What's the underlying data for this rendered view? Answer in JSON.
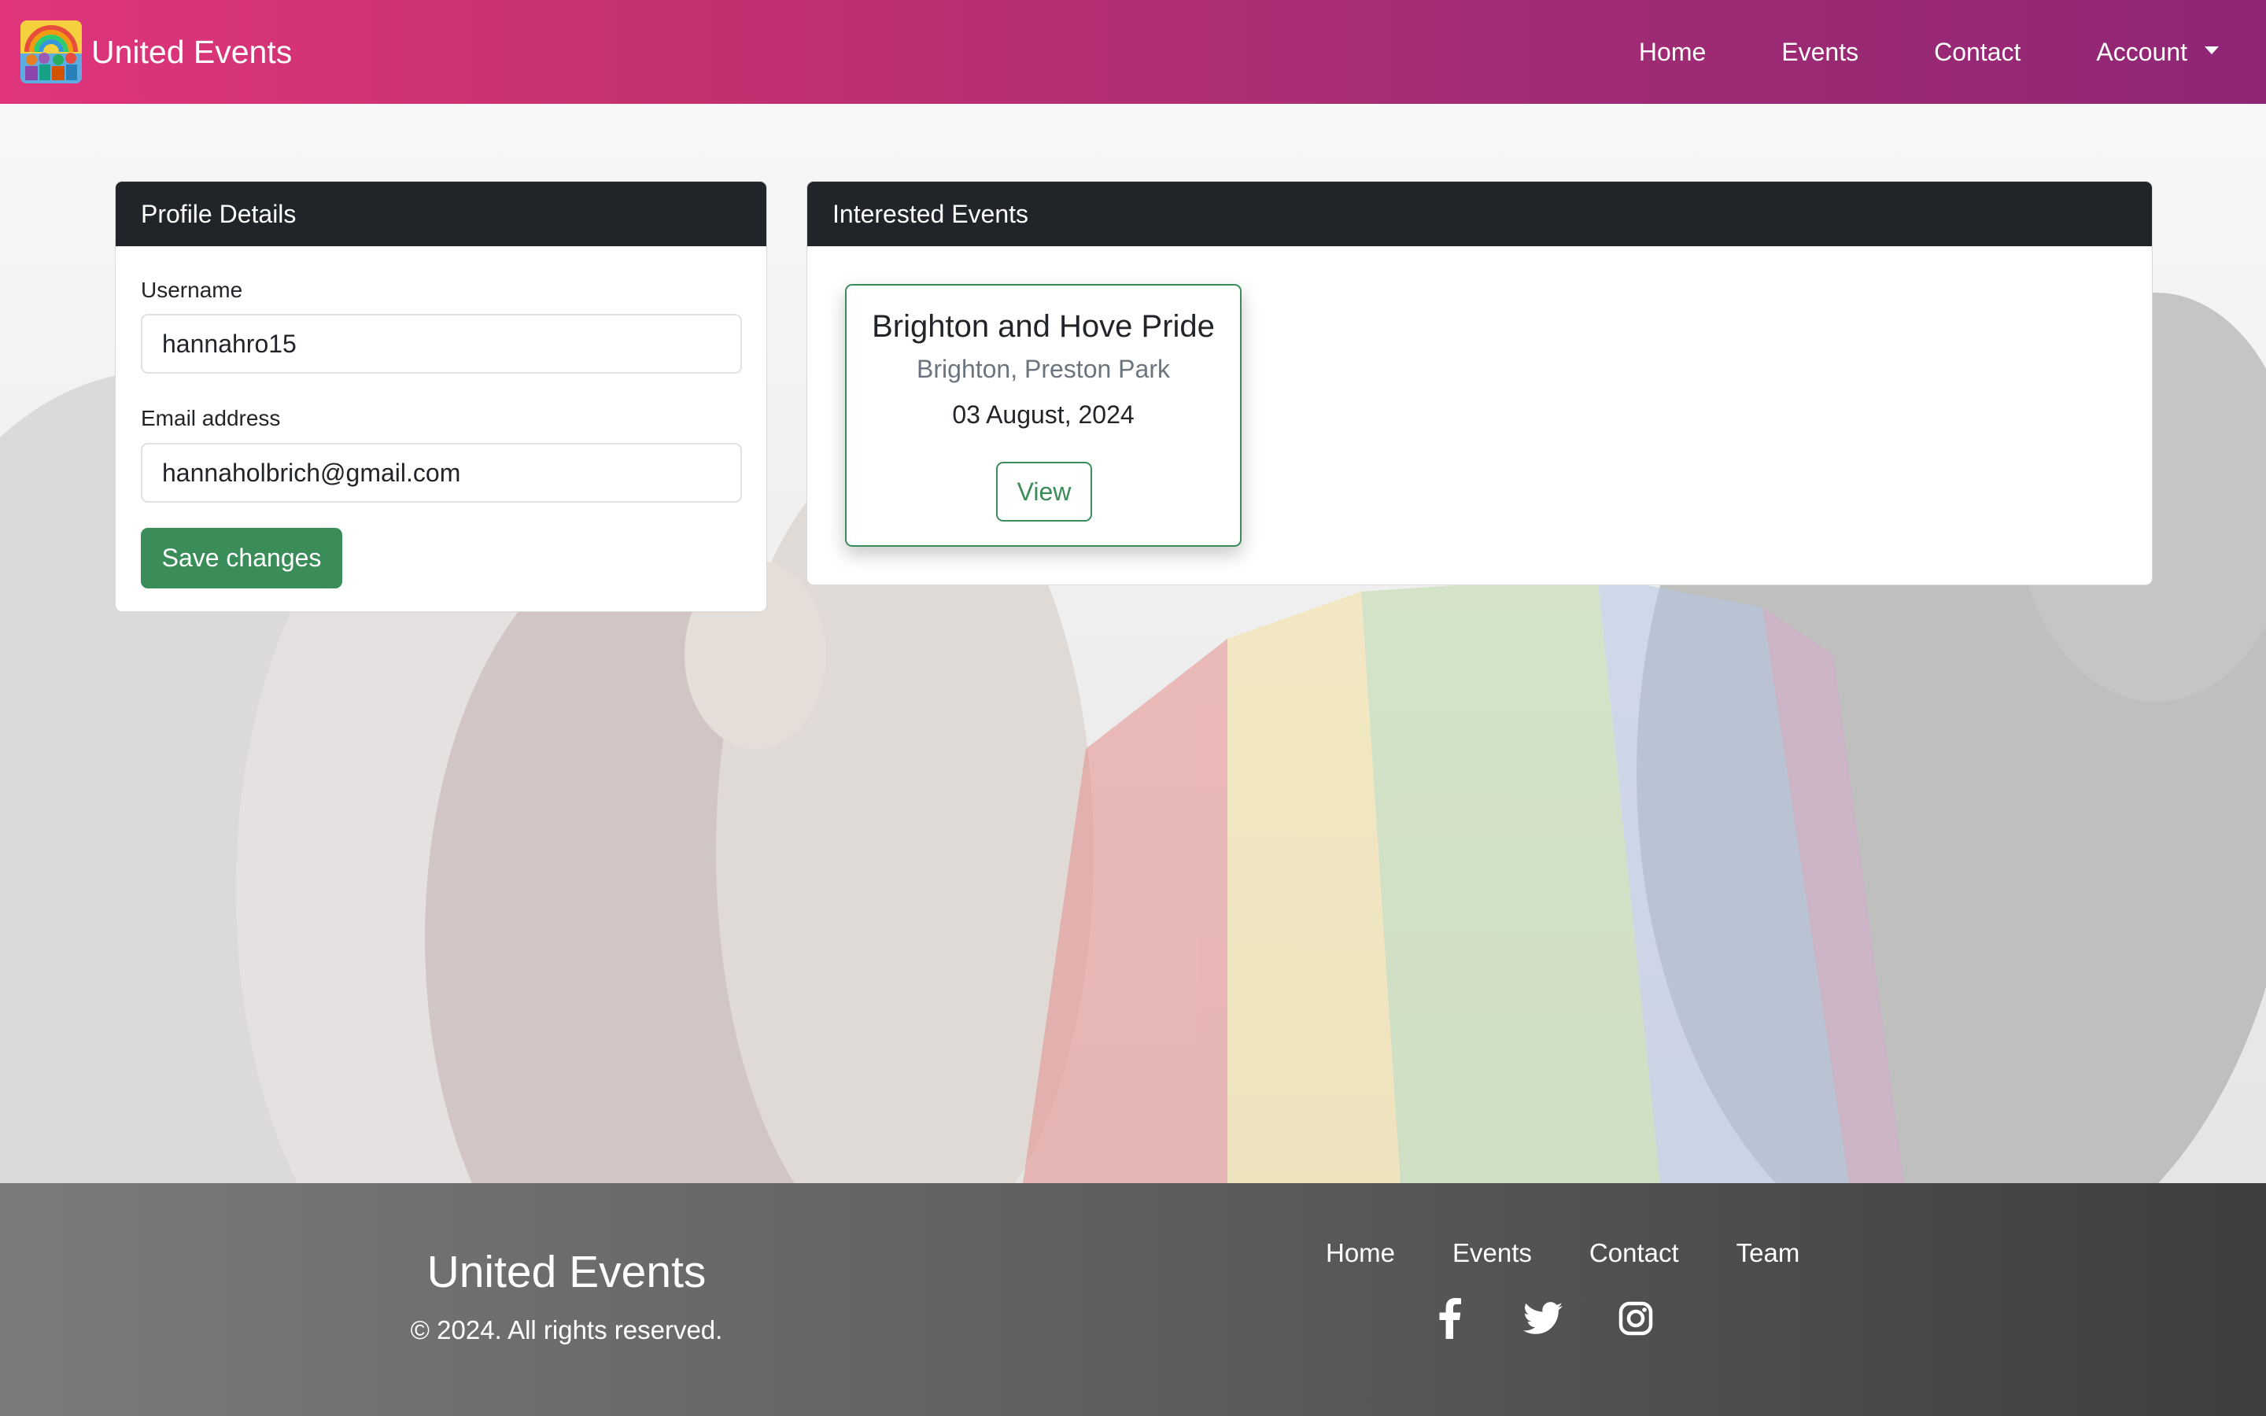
{
  "nav": {
    "brand": "United Events",
    "links": [
      "Home",
      "Events",
      "Contact",
      "Account"
    ]
  },
  "profile": {
    "header": "Profile Details",
    "username_label": "Username",
    "username_value": "hannahro15",
    "email_label": "Email address",
    "email_value": "hannaholbrich@gmail.com",
    "save_label": "Save changes"
  },
  "interested": {
    "header": "Interested Events",
    "events": [
      {
        "title": "Brighton and Hove Pride",
        "location": "Brighton, Preston Park",
        "date": "03 August, 2024",
        "view_label": "View"
      }
    ]
  },
  "footer": {
    "brand": "United Events",
    "copyright": "© 2024. All rights reserved.",
    "links": [
      "Home",
      "Events",
      "Contact",
      "Team"
    ],
    "social": [
      "facebook-icon",
      "twitter-icon",
      "instagram-icon"
    ]
  },
  "colors": {
    "nav_gradient_start": "#e0357c",
    "nav_gradient_end": "#8f2675",
    "card_header": "#212529",
    "accent_green": "#3a8c58"
  }
}
